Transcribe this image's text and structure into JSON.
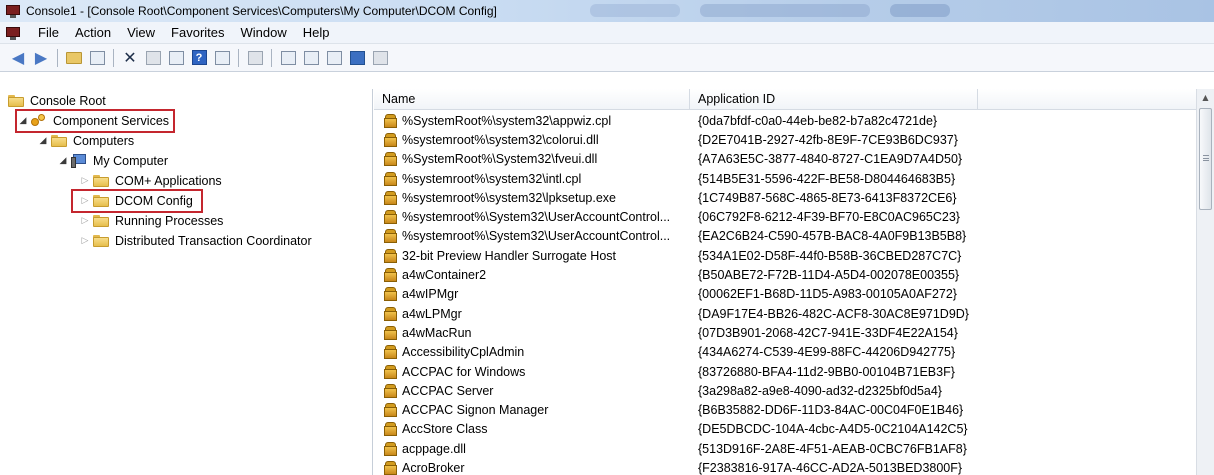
{
  "window": {
    "title": "Console1 - [Console Root\\Component Services\\Computers\\My Computer\\DCOM Config]"
  },
  "menu": [
    "File",
    "Action",
    "View",
    "Favorites",
    "Window",
    "Help"
  ],
  "tree": {
    "root": "Console Root",
    "component_services": "Component Services",
    "computers": "Computers",
    "my_computer": "My Computer",
    "com_plus": "COM+ Applications",
    "dcom_config": "DCOM Config",
    "running_processes": "Running Processes",
    "dtc": "Distributed Transaction Coordinator"
  },
  "list": {
    "columns": {
      "name": "Name",
      "application_id": "Application ID"
    },
    "rows": [
      {
        "name": "%SystemRoot%\\system32\\appwiz.cpl",
        "app_id": "{0da7bfdf-c0a0-44eb-be82-b7a82c4721de}"
      },
      {
        "name": "%systemroot%\\system32\\colorui.dll",
        "app_id": "{D2E7041B-2927-42fb-8E9F-7CE93B6DC937}"
      },
      {
        "name": "%SystemRoot%\\System32\\fveui.dll",
        "app_id": "{A7A63E5C-3877-4840-8727-C1EA9D7A4D50}"
      },
      {
        "name": "%systemroot%\\system32\\intl.cpl",
        "app_id": "{514B5E31-5596-422F-BE58-D804464683B5}"
      },
      {
        "name": "%systemroot%\\system32\\lpksetup.exe",
        "app_id": "{1C749B87-568C-4865-8E73-6413F8372CE6}"
      },
      {
        "name": "%systemroot%\\System32\\UserAccountControl...",
        "app_id": "{06C792F8-6212-4F39-BF70-E8C0AC965C23}"
      },
      {
        "name": "%systemroot%\\System32\\UserAccountControl...",
        "app_id": "{EA2C6B24-C590-457B-BAC8-4A0F9B13B5B8}"
      },
      {
        "name": "32-bit Preview Handler Surrogate Host",
        "app_id": "{534A1E02-D58F-44f0-B58B-36CBED287C7C}"
      },
      {
        "name": "a4wContainer2",
        "app_id": "{B50ABE72-F72B-11D4-A5D4-002078E00355}"
      },
      {
        "name": "a4wIPMgr",
        "app_id": "{00062EF1-B68D-11D5-A983-00105A0AF272}"
      },
      {
        "name": "a4wLPMgr",
        "app_id": "{DA9F17E4-BB26-482C-ACF8-30AC8E971D9D}"
      },
      {
        "name": "a4wMacRun",
        "app_id": "{07D3B901-2068-42C7-941E-33DF4E22A154}"
      },
      {
        "name": "AccessibilityCplAdmin",
        "app_id": "{434A6274-C539-4E99-88FC-44206D942775}"
      },
      {
        "name": "ACCPAC for Windows",
        "app_id": "{83726880-BFA4-11d2-9BB0-00104B71EB3F}"
      },
      {
        "name": "ACCPAC Server",
        "app_id": "{3a298a82-a9e8-4090-ad32-d2325bf0d5a4}"
      },
      {
        "name": "ACCPAC Signon Manager",
        "app_id": "{B6B35882-DD6F-11D3-84AC-00C04F0E1B46}"
      },
      {
        "name": "AccStore Class",
        "app_id": "{DE5DBCDC-104A-4cbc-A4D5-0C2104A142C5}"
      },
      {
        "name": "acppage.dll",
        "app_id": "{513D916F-2A8E-4F51-AEAB-0CBC76FB1AF8}"
      },
      {
        "name": "AcroBroker",
        "app_id": "{F2383816-917A-46CC-AD2A-5013BED3800F}"
      }
    ]
  },
  "highlight_color": "#c4262e"
}
